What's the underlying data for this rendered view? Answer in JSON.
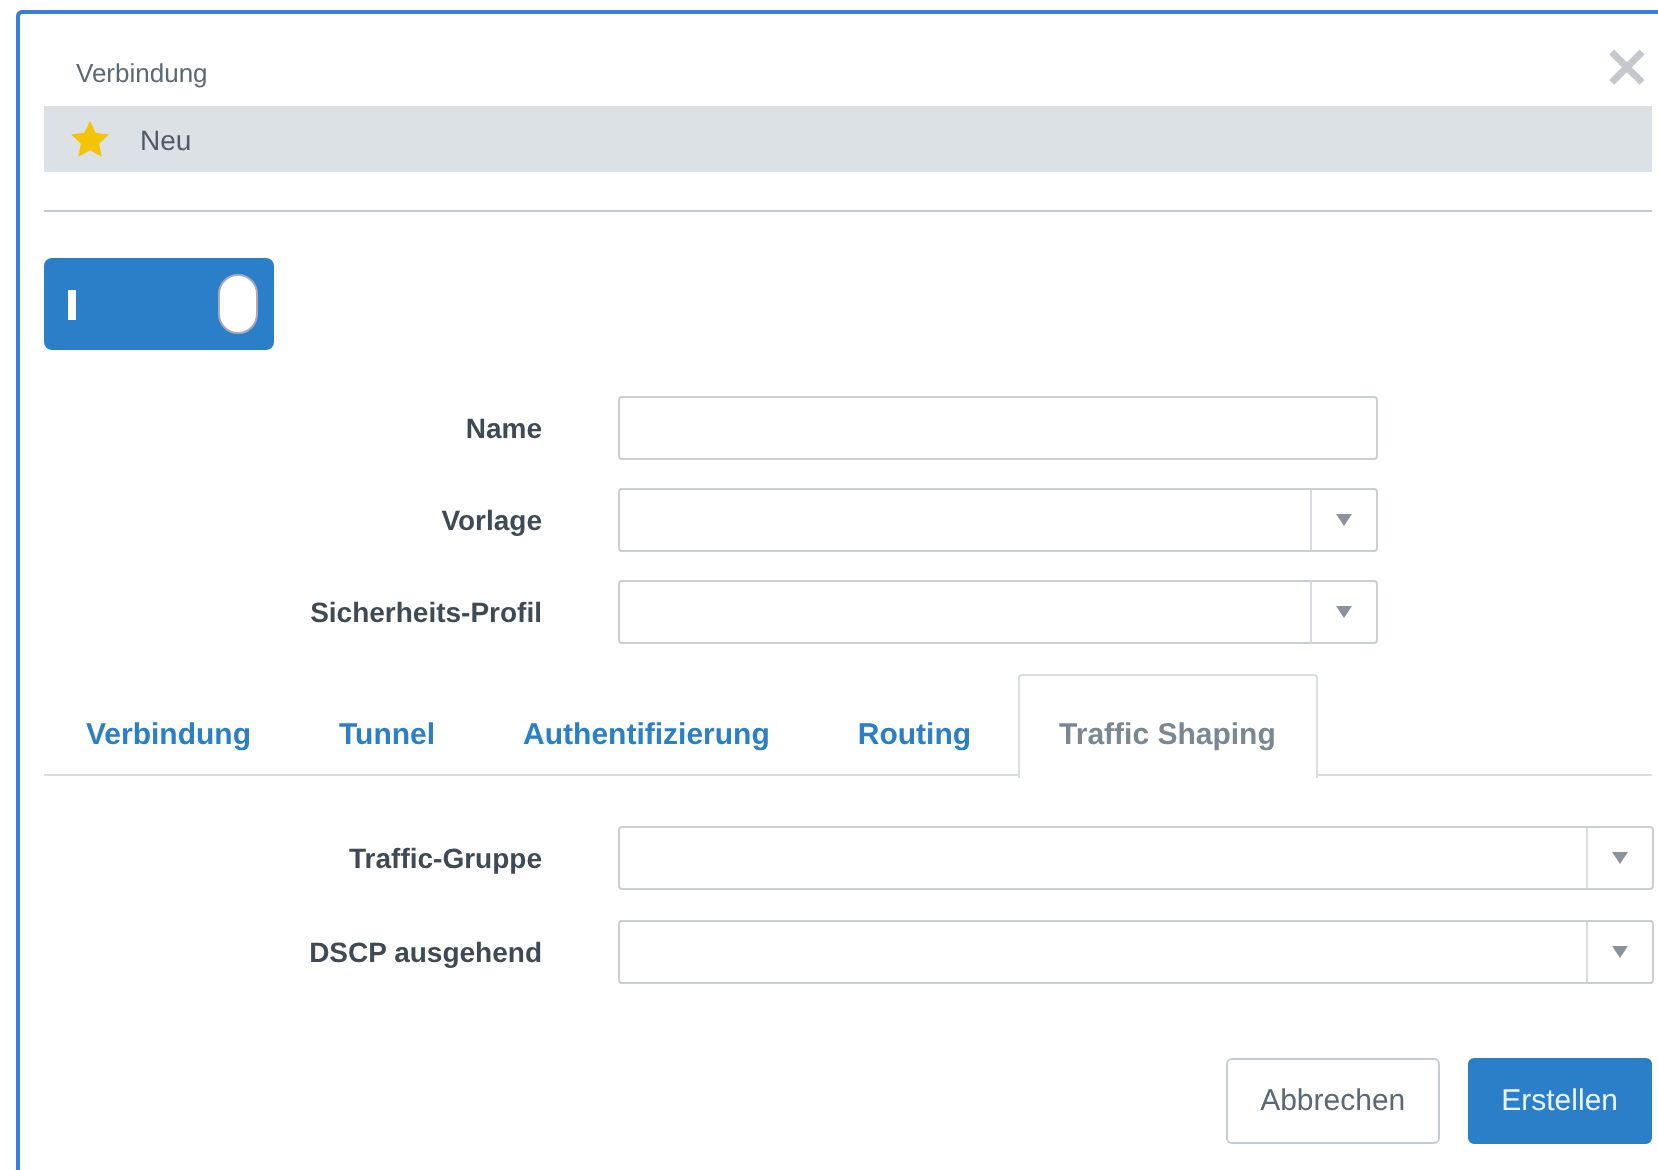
{
  "dialog": {
    "title": "Verbindung",
    "close": "×"
  },
  "header": {
    "label": "Neu"
  },
  "toggle": {
    "on": true
  },
  "fields": [
    {
      "label": "Name",
      "kind": "text"
    },
    {
      "label": "Vorlage",
      "kind": "select"
    },
    {
      "label": "Sicherheits-Profil",
      "kind": "select"
    }
  ],
  "tabs": [
    {
      "label": "Verbindung",
      "selected": false
    },
    {
      "label": "Tunnel",
      "selected": false
    },
    {
      "label": "Authentifizierung",
      "selected": false
    },
    {
      "label": "Routing",
      "selected": false
    },
    {
      "label": "Traffic Shaping",
      "selected": true
    }
  ],
  "tab_fields": [
    {
      "label": "Traffic-Gruppe",
      "kind": "select"
    },
    {
      "label": "DSCP ausgehend",
      "kind": "select"
    }
  ],
  "buttons": [
    {
      "label": "Abbrechen",
      "kind": "secondary"
    },
    {
      "label": "Erstellen",
      "kind": "primary"
    }
  ]
}
